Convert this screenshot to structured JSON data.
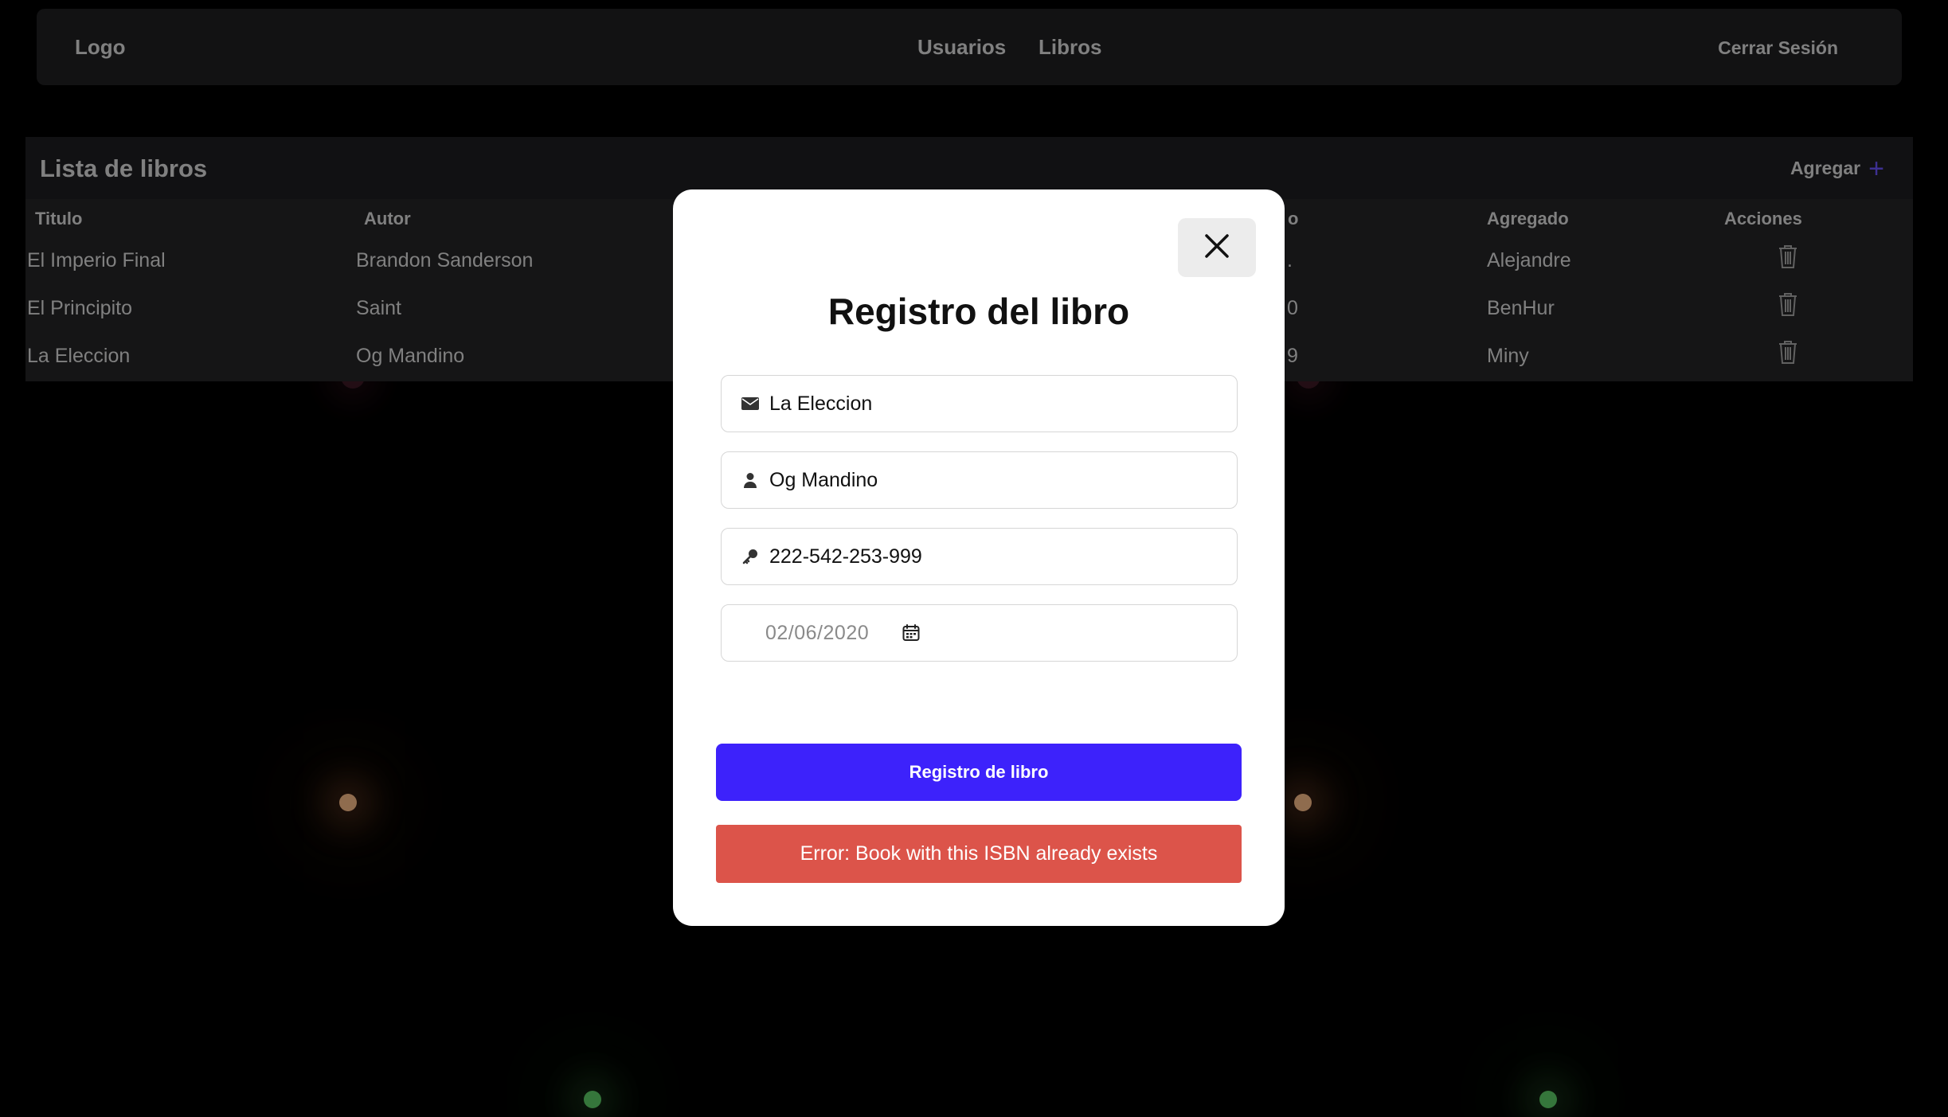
{
  "colors": {
    "background": "#000000",
    "panel": "#1f1f21",
    "accent": "#3d22fb",
    "error": "#dc544a",
    "add_plus": "#5a48d8"
  },
  "header": {
    "logo": "Logo",
    "nav": [
      "Usuarios",
      "Libros"
    ],
    "logout": "Cerrar Sesión"
  },
  "table": {
    "title": "Lista de libros",
    "add_label": "Agregar",
    "add_icon": "plus-icon",
    "columns": {
      "titulo": "Titulo",
      "autor": "Autor",
      "hidden_partial": "o",
      "agregado": "Agregado",
      "acciones": "Acciones"
    },
    "rows": [
      {
        "titulo": "El Imperio Final",
        "autor": "Brandon Sanderson",
        "partial": ".",
        "agregado": "Alejandre",
        "action_icon": "trash-icon"
      },
      {
        "titulo": "El Principito",
        "autor": "Saint",
        "partial": "0",
        "agregado": "BenHur",
        "action_icon": "trash-icon"
      },
      {
        "titulo": "La Eleccion",
        "autor": "Og Mandino",
        "partial": "9",
        "agregado": "Miny",
        "action_icon": "trash-icon"
      }
    ]
  },
  "modal": {
    "close_icon": "close-icon",
    "title": "Registro del libro",
    "fields": {
      "title_value": "La Eleccion",
      "title_icon": "envelope-icon",
      "author_value": "Og Mandino",
      "author_icon": "user-icon",
      "isbn_value": "222-542-253-999",
      "isbn_icon": "key-icon",
      "date_value": "02/06/2020",
      "date_icon": "calendar-icon"
    },
    "submit_label": "Registro de libro",
    "error_message": "Error: Book with this ISBN already exists"
  }
}
